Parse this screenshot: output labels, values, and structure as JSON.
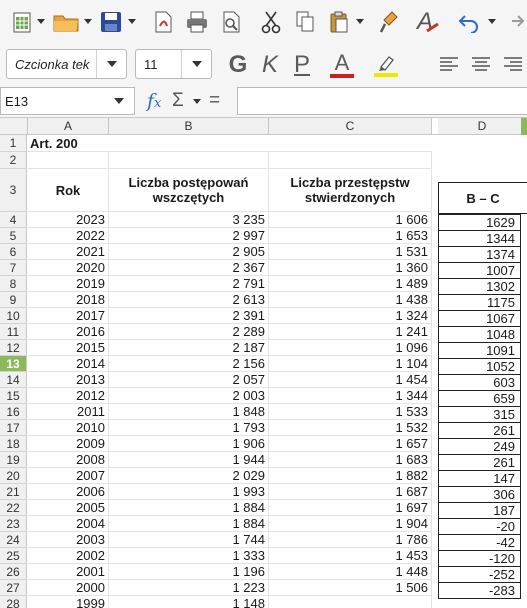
{
  "toolbar": {
    "font_name": "Czcionka tek",
    "font_size": "11",
    "bold_label": "G",
    "italic_label": "K",
    "underline_label": "P",
    "font_color_label": "A",
    "clear_format_label": "A"
  },
  "colors": {
    "accent_row": "#8bb95c",
    "font_color": "#cc1f1f",
    "highlight": "#f2e600",
    "save_blue": "#2c4a9a",
    "cut_red": "#c0392b"
  },
  "formula_bar": {
    "name_box": "E13",
    "fx_label": "f",
    "fx_sub": "x",
    "sigma_label": "Σ",
    "equals_label": "="
  },
  "columns": [
    "A",
    "B",
    "C",
    "D"
  ],
  "sheet": {
    "title": "Art. 200",
    "header_rok": "Rok",
    "header_b": "Liczba postępowań wszczętych",
    "header_c": "Liczba przestępstw stwierdzonych",
    "header_d": "B – C",
    "selected_row": 13,
    "rows": [
      {
        "n": "4",
        "rok": "2023",
        "b": "3 235",
        "c": "1 606",
        "d": "1629"
      },
      {
        "n": "5",
        "rok": "2022",
        "b": "2 997",
        "c": "1 653",
        "d": "1344"
      },
      {
        "n": "6",
        "rok": "2021",
        "b": "2 905",
        "c": "1 531",
        "d": "1374"
      },
      {
        "n": "7",
        "rok": "2020",
        "b": "2 367",
        "c": "1 360",
        "d": "1007"
      },
      {
        "n": "8",
        "rok": "2019",
        "b": "2 791",
        "c": "1 489",
        "d": "1302"
      },
      {
        "n": "9",
        "rok": "2018",
        "b": "2 613",
        "c": "1 438",
        "d": "1175"
      },
      {
        "n": "10",
        "rok": "2017",
        "b": "2 391",
        "c": "1 324",
        "d": "1067"
      },
      {
        "n": "11",
        "rok": "2016",
        "b": "2 289",
        "c": "1 241",
        "d": "1048"
      },
      {
        "n": "12",
        "rok": "2015",
        "b": "2 187",
        "c": "1 096",
        "d": "1091"
      },
      {
        "n": "13",
        "rok": "2014",
        "b": "2 156",
        "c": "1 104",
        "d": "1052"
      },
      {
        "n": "14",
        "rok": "2013",
        "b": "2 057",
        "c": "1 454",
        "d": "603"
      },
      {
        "n": "15",
        "rok": "2012",
        "b": "2 003",
        "c": "1 344",
        "d": "659"
      },
      {
        "n": "16",
        "rok": "2011",
        "b": "1 848",
        "c": "1 533",
        "d": "315"
      },
      {
        "n": "17",
        "rok": "2010",
        "b": "1 793",
        "c": "1 532",
        "d": "261"
      },
      {
        "n": "18",
        "rok": "2009",
        "b": "1 906",
        "c": "1 657",
        "d": "249"
      },
      {
        "n": "19",
        "rok": "2008",
        "b": "1 944",
        "c": "1 683",
        "d": "261"
      },
      {
        "n": "20",
        "rok": "2007",
        "b": "2 029",
        "c": "1 882",
        "d": "147"
      },
      {
        "n": "21",
        "rok": "2006",
        "b": "1 993",
        "c": "1 687",
        "d": "306"
      },
      {
        "n": "22",
        "rok": "2005",
        "b": "1 884",
        "c": "1 697",
        "d": "187"
      },
      {
        "n": "23",
        "rok": "2004",
        "b": "1 884",
        "c": "1 904",
        "d": "-20"
      },
      {
        "n": "24",
        "rok": "2003",
        "b": "1 744",
        "c": "1 786",
        "d": "-42"
      },
      {
        "n": "25",
        "rok": "2002",
        "b": "1 333",
        "c": "1 453",
        "d": "-120"
      },
      {
        "n": "26",
        "rok": "2001",
        "b": "1 196",
        "c": "1 448",
        "d": "-252"
      },
      {
        "n": "27",
        "rok": "2000",
        "b": "1 223",
        "c": "1 506",
        "d": "-283"
      },
      {
        "n": "28",
        "rok": "1999",
        "b": "1 148",
        "c": "",
        "d": ""
      }
    ]
  }
}
